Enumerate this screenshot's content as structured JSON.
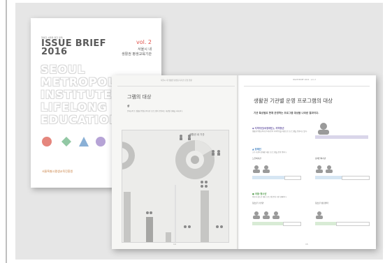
{
  "cover": {
    "eyebrow": "행복한 서울을 위한 정책",
    "title": "ISSUE BRIEF",
    "year": "2016",
    "vol": "vol. 2",
    "subtitle_1": "서울시 내",
    "subtitle_2": "생활권 평생교육기관",
    "background_words": [
      "SEOUL",
      "METROPOLITAN",
      "INSTITUTE FOR",
      "LIFELONG",
      "EDUCATION"
    ],
    "seal_colors": [
      "#e5867d",
      "#92c8a4",
      "#8ab0d6",
      "#b6a3d6",
      "#e79e78",
      "#d8d466"
    ],
    "publisher": "서울특별시평생교육진흥원"
  },
  "left_page": {
    "header": "서울시 내 생활권 평생교육기관 운영 현황",
    "title": "그램의 대상",
    "subtitle": "상",
    "intro": "문해교육 등 생활권 평생교육기관 프로그램이 운영되는 대상별 현황을 나타낸다.",
    "chart_head": "생활권 내 기관",
    "page_num": "14"
  },
  "right_page": {
    "header": "ISSUE BRIEF 2016 · vol. 2",
    "title": "생활권 기관별 운영 프로그램의 대상",
    "subtitle": "기관 특성별로 현재 운영하는 프로그램 대상을 나타낸 결과이다.",
    "section_1": "◆ 지역주민(비장애인), 지역청년",
    "section_1_text": "생활권 평생교육기관 대부분이 지역주민을 대상으로 프로그램을 운영하고 있다.",
    "section_2": "▲ 장애인",
    "section_2_text": "소수 기관이 장애인 대상 프로그램을 운영 중이다.",
    "col_a_title": "노인복지관",
    "col_b_title": "장애인복지관",
    "section_3": "● 아동·청소년",
    "section_3_text": "아동과 청소년 대상 프로그램 운영 기관 현황이다.",
    "col_c_title": "청소년 수련관",
    "col_d_title": "청소년 상담센터",
    "page_num": "15"
  }
}
